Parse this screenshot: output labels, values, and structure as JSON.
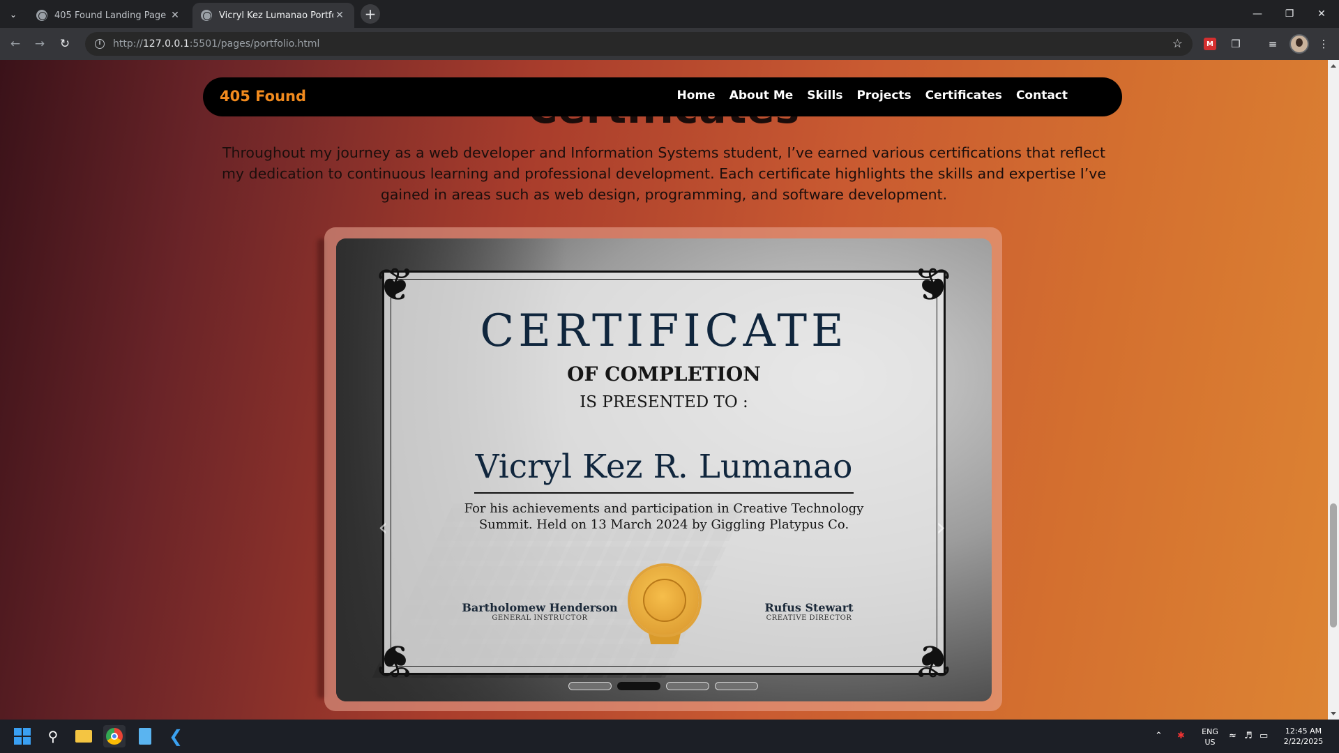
{
  "browser": {
    "tabs": [
      {
        "title": "405 Found Landing Page",
        "active": false
      },
      {
        "title": "Vicryl Kez Lumanao Portfolio",
        "active": true
      }
    ],
    "url_prefix": "http://",
    "url_host": "127.0.0.1",
    "url_rest": ":5501/pages/portfolio.html"
  },
  "site": {
    "logo": "405 Found",
    "nav": [
      "Home",
      "About Me",
      "Skills",
      "Projects",
      "Certificates",
      "Contact"
    ],
    "section_heading": "Certificates",
    "intro": "Throughout my journey as a web developer and Information Systems student, I’ve earned various certifications that reflect my dedication to continuous learning and professional development. Each certificate highlights the skills and expertise I’ve gained in areas such as web design, programming, and software development."
  },
  "certificate": {
    "title": "CERTIFICATE",
    "subtitle": "OF COMPLETION",
    "presented": "IS PRESENTED TO :",
    "name": "Vicryl Kez R. Lumanao",
    "description": "For his achievements and participation in Creative Technology Summit. Held on 13 March 2024 by Giggling Platypus Co.",
    "signer_left": {
      "name": "Bartholomew Henderson",
      "role": "GENERAL INSTRUCTOR"
    },
    "signer_right": {
      "name": "Rufus Stewart",
      "role": "CREATIVE DIRECTOR"
    }
  },
  "carousel": {
    "slide_count": 4,
    "active_index": 1
  },
  "taskbar": {
    "lang": "ENG",
    "region": "US",
    "time": "12:45 AM",
    "date": "2/22/2025"
  }
}
